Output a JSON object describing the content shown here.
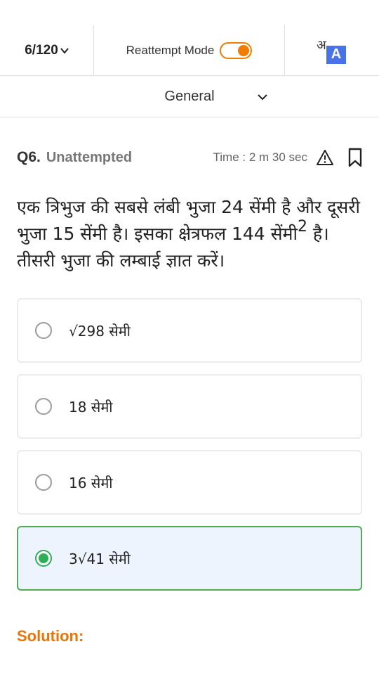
{
  "header": {
    "question_counter": "6/120",
    "reattempt_label": "Reattempt Mode",
    "reattempt_on": true,
    "language_icon_hi": "अ",
    "language_icon_en": "A",
    "accent_color": "#f07c00"
  },
  "section": {
    "name": "General"
  },
  "question": {
    "number": "Q6.",
    "status": "Unattempted",
    "time": "Time : 2 m 30 sec",
    "text": "एक त्रिभुज की सबसे लंबी भुजा 24 सेंमी है और दूसरी भुजा 15 सेंमी है। इसका क्षेत्रफल 144 सेंमी",
    "text_sup": "2",
    "text_tail": " है। तीसरी भुजा की लम्बाई ज्ञात करें।"
  },
  "options": [
    {
      "label": "√298 सेमी",
      "selected": false
    },
    {
      "label": "18 सेमी",
      "selected": false
    },
    {
      "label": "16 सेमी",
      "selected": false
    },
    {
      "label": "3√41 सेमी",
      "selected": true
    }
  ],
  "solution": {
    "heading": "Solution:"
  },
  "colors": {
    "selected_border": "#4caf50",
    "selected_bg": "#eef4fd",
    "solution_heading": "#e8740c"
  }
}
